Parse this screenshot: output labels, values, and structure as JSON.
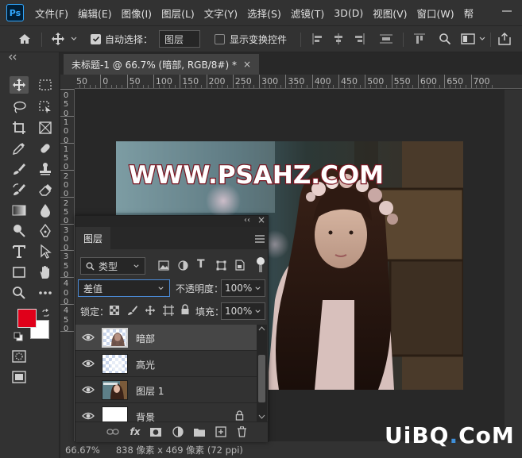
{
  "app": {
    "logo": "Ps"
  },
  "menubar": {
    "items": [
      "文件(F)",
      "编辑(E)",
      "图像(I)",
      "图层(L)",
      "文字(Y)",
      "选择(S)",
      "滤镜(T)",
      "3D(D)",
      "视图(V)",
      "窗口(W)",
      "帮"
    ]
  },
  "options": {
    "auto_select_label": "自动选择：",
    "auto_select_target": "图层",
    "show_transform_label": "显示变换控件"
  },
  "document": {
    "tab_title": "未标题-1 @ 66.7% (暗部, RGB/8#) *",
    "close_glyph": "×",
    "watermark_text": "WWW.PSAHZ.COM"
  },
  "rulers": {
    "h_labels": [
      "50",
      "0",
      "50",
      "100",
      "150",
      "200",
      "250",
      "300",
      "350",
      "400",
      "450",
      "500",
      "550",
      "600",
      "650",
      "700"
    ],
    "v_labels": [
      "0",
      "5",
      "0",
      "1",
      "0",
      "0",
      "1",
      "5",
      "0",
      "2",
      "0",
      "0",
      "2",
      "5",
      "0",
      "3",
      "0",
      "0",
      "3",
      "5",
      "0",
      "4",
      "0",
      "0",
      "4",
      "5",
      "0"
    ]
  },
  "status": {
    "zoom": "66.67%",
    "info": "838 像素 x 469 像素 (72 ppi)"
  },
  "layers_panel": {
    "tab_label": "图层",
    "collapse_glyph": "‹‹",
    "close_glyph": "×",
    "filter_kind": "类型",
    "blend_mode": "差值",
    "opacity_label": "不透明度：",
    "opacity_value": "100%",
    "lock_label": "锁定：",
    "fill_label": "填充：",
    "fill_value": "100%",
    "layers": [
      {
        "name": "暗部"
      },
      {
        "name": "高光"
      },
      {
        "name": "图层 1"
      },
      {
        "name": "背景"
      }
    ],
    "footer_icons": [
      "link-icon",
      "fx-icon",
      "mask-icon",
      "adjustment-icon",
      "folder-icon",
      "new-layer-icon",
      "trash-icon"
    ]
  },
  "site_watermark": {
    "part1": "UiBQ",
    "dot": ".",
    "part2": "CoM"
  },
  "colors": {
    "foreground": "#e0001a",
    "background": "#ffffff",
    "accent": "#31a8ff"
  }
}
